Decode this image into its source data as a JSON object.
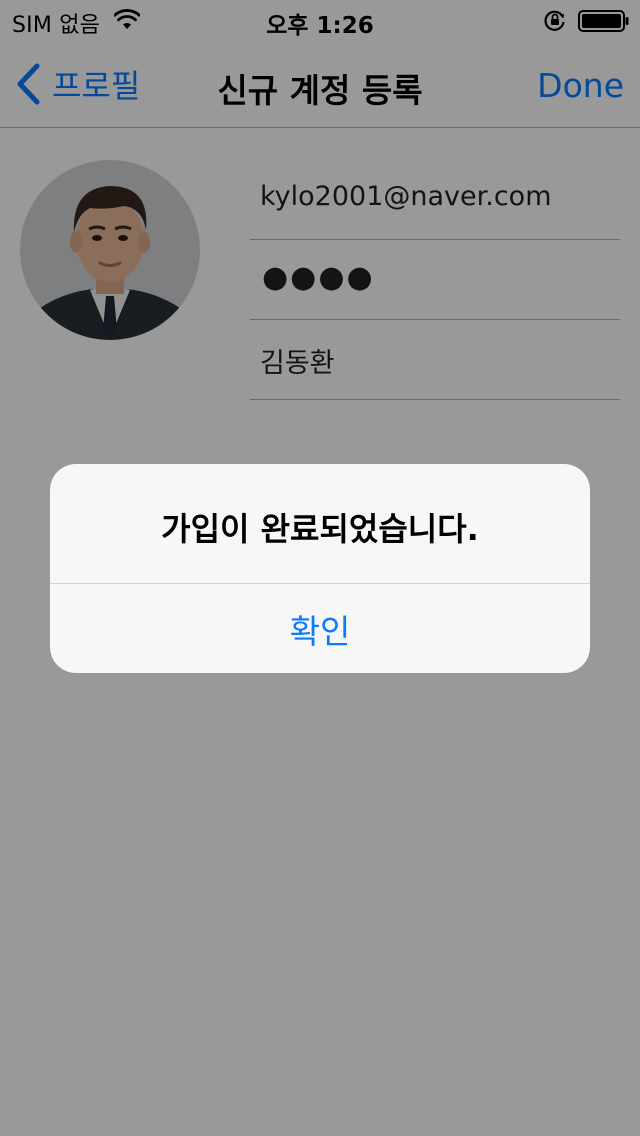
{
  "status_bar": {
    "carrier": "SIM 없음",
    "time": "오후 1:26",
    "icons": [
      "wifi-icon",
      "lock-rotation-icon",
      "battery-icon"
    ]
  },
  "nav": {
    "back_label": "프로필",
    "title": "신규 계정 등록",
    "done_label": "Done",
    "back_icon": "chevron-left-icon"
  },
  "form": {
    "email": "kylo2001@naver.com",
    "password_masked": "●●●●",
    "name": "김동환",
    "avatar": "profile-photo"
  },
  "alert": {
    "message": "가입이 완료되었습니다.",
    "confirm_label": "확인"
  },
  "colors": {
    "accent": "#0a7aff",
    "separator": "#b2b2b2",
    "alert_background": "#f7f7f7",
    "overlay": "rgba(0,0,0,0.40)"
  }
}
